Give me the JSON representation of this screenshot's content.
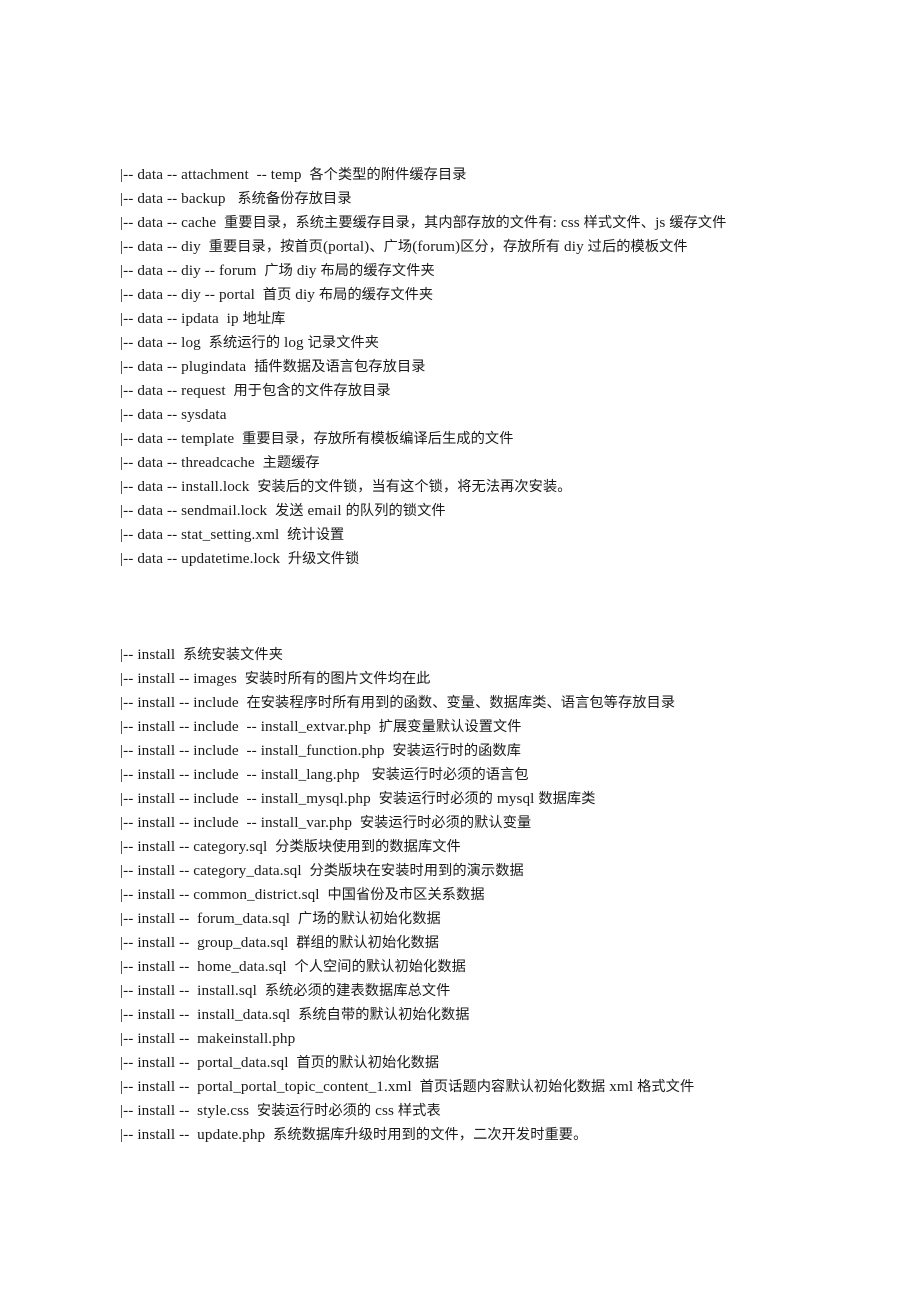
{
  "document": {
    "background_color": "#ffffff",
    "text_color": "#1a1a1a",
    "sections": [
      {
        "id": "data-directory",
        "name": "data",
        "lines": [
          "|-- data -- attachment  -- temp  各个类型的附件缓存目录",
          "|-- data -- backup   系统备份存放目录",
          "|-- data -- cache  重要目录，系统主要缓存目录，其内部存放的文件有: css 样式文件、js 缓存文件",
          "|-- data -- diy  重要目录，按首页(portal)、广场(forum)区分，存放所有 diy 过后的模板文件",
          "|-- data -- diy -- forum  广场 diy 布局的缓存文件夹",
          "|-- data -- diy -- portal  首页 diy 布局的缓存文件夹",
          "|-- data -- ipdata  ip 地址库",
          "|-- data -- log  系统运行的 log 记录文件夹",
          "|-- data -- plugindata  插件数据及语言包存放目录",
          "|-- data -- request  用于包含的文件存放目录",
          "|-- data -- sysdata",
          "|-- data -- template  重要目录，存放所有模板编译后生成的文件",
          "|-- data -- threadcache  主题缓存",
          "|-- data -- install.lock  安装后的文件锁，当有这个锁，将无法再次安装。",
          "|-- data -- sendmail.lock  发送 email 的队列的锁文件",
          "|-- data -- stat_setting.xml  统计设置",
          "|-- data -- updatetime.lock  升级文件锁"
        ]
      },
      {
        "id": "install-directory",
        "name": "install",
        "lines": [
          "|-- install  系统安装文件夹",
          "|-- install -- images  安装时所有的图片文件均在此",
          "|-- install -- include  在安装程序时所有用到的函数、变量、数据库类、语言包等存放目录",
          "|-- install -- include  -- install_extvar.php  扩展变量默认设置文件",
          "|-- install -- include  -- install_function.php  安装运行时的函数库",
          "|-- install -- include  -- install_lang.php   安装运行时必须的语言包",
          "|-- install -- include  -- install_mysql.php  安装运行时必须的 mysql 数据库类",
          "|-- install -- include  -- install_var.php  安装运行时必须的默认变量",
          "|-- install -- category.sql  分类版块使用到的数据库文件",
          "|-- install -- category_data.sql  分类版块在安装时用到的演示数据",
          "|-- install -- common_district.sql  中国省份及市区关系数据",
          "|-- install --  forum_data.sql  广场的默认初始化数据",
          "|-- install --  group_data.sql  群组的默认初始化数据",
          "|-- install --  home_data.sql  个人空间的默认初始化数据",
          "|-- install --  install.sql  系统必须的建表数据库总文件",
          "|-- install --  install_data.sql  系统自带的默认初始化数据",
          "|-- install --  makeinstall.php",
          "|-- install --  portal_data.sql  首页的默认初始化数据",
          "|-- install --  portal_portal_topic_content_1.xml  首页话题内容默认初始化数据 xml 格式文件",
          "|-- install --  style.css  安装运行时必须的 css 样式表",
          "|-- install --  update.php  系统数据库升级时用到的文件，二次开发时重要。"
        ]
      }
    ]
  }
}
